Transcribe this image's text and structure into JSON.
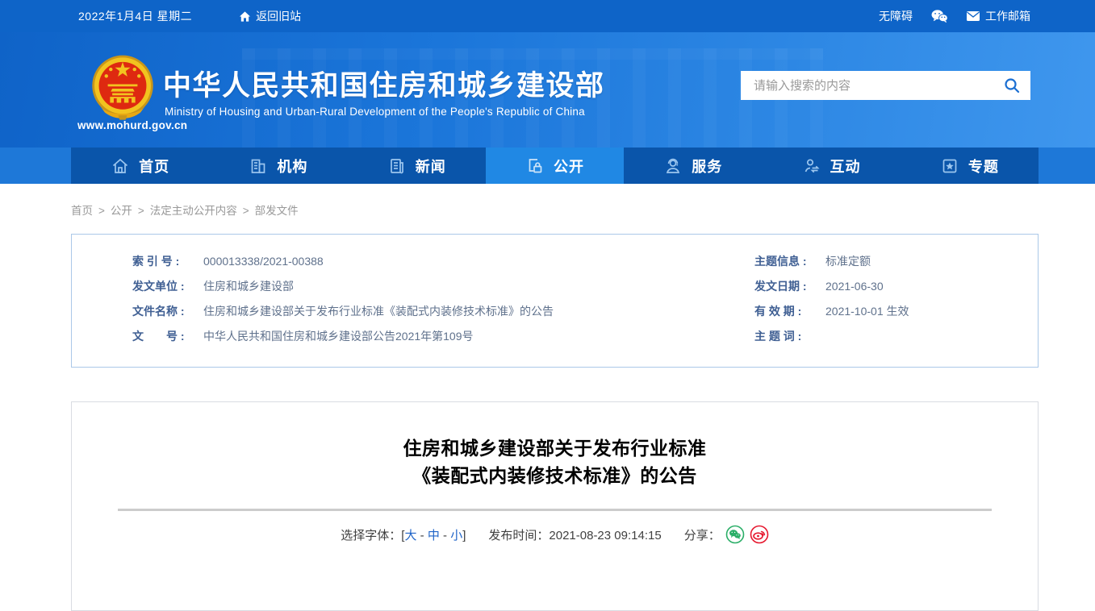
{
  "topbar": {
    "date": "2022年1月4日 星期二",
    "back_old_site": "返回旧站",
    "accessibility": "无障碍",
    "work_mail": "工作邮箱"
  },
  "header": {
    "site_title": "中华人民共和国住房和城乡建设部",
    "site_subtitle_en": "Ministry of Housing and Urban-Rural Development of the People's Republic of China",
    "site_url": "www.mohurd.gov.cn",
    "search_placeholder": "请输入搜索的内容",
    "search_icon": "search-icon",
    "logo_icon": "national-emblem"
  },
  "nav": {
    "items": [
      {
        "label": "首页",
        "icon": "home-icon",
        "active": false
      },
      {
        "label": "机构",
        "icon": "organization-icon",
        "active": false
      },
      {
        "label": "新闻",
        "icon": "news-icon",
        "active": false
      },
      {
        "label": "公开",
        "icon": "disclosure-icon",
        "active": true
      },
      {
        "label": "服务",
        "icon": "service-icon",
        "active": false
      },
      {
        "label": "互动",
        "icon": "interaction-icon",
        "active": false
      },
      {
        "label": "专题",
        "icon": "special-topic-icon",
        "active": false
      }
    ]
  },
  "breadcrumb": {
    "separator": ">",
    "items": [
      "首页",
      "公开",
      "法定主动公开内容",
      "部发文件"
    ]
  },
  "doc_meta": {
    "left": [
      {
        "label": "索 引 号 :",
        "value": "000013338/2021-00388"
      },
      {
        "label": "发文单位 :",
        "value": "住房和城乡建设部"
      },
      {
        "label": "文件名称 :",
        "value": "住房和城乡建设部关于发布行业标准《装配式内装修技术标准》的公告"
      },
      {
        "label": "文　　号 :",
        "value": "中华人民共和国住房和城乡建设部公告2021年第109号"
      }
    ],
    "right": [
      {
        "label": "主题信息 :",
        "value": "标准定额"
      },
      {
        "label": "发文日期 :",
        "value": "2021-06-30"
      },
      {
        "label": "有 效 期 :",
        "value": "2021-10-01 生效"
      },
      {
        "label": "主 题 词 :",
        "value": ""
      }
    ]
  },
  "article": {
    "title_line1": "住房和城乡建设部关于发布行业标准",
    "title_line2": "《装配式内装修技术标准》的公告",
    "font_bar": {
      "label": "选择字体：",
      "bracket_open": "[",
      "separator": " - ",
      "bracket_close": "]",
      "sizes": [
        "大",
        "中",
        "小"
      ]
    },
    "publish": {
      "label": "发布时间：",
      "value": "2021-08-23 09:14:15"
    },
    "share": {
      "label": "分享：",
      "icons": [
        "wechat-share-icon",
        "weibo-share-icon"
      ]
    }
  },
  "colors": {
    "topbar_blue": "#0e64c8",
    "nav_dark_blue": "#0a55aa",
    "nav_active_blue": "#2088e4",
    "link_blue": "#1f64c8",
    "meta_label_blue": "#3f5f93",
    "meta_border_blue": "#abc8e8",
    "wechat_green": "#2aae67",
    "weibo_red": "#e6162d",
    "emblem_red": "#de2910",
    "emblem_gold": "#f2c31f"
  }
}
